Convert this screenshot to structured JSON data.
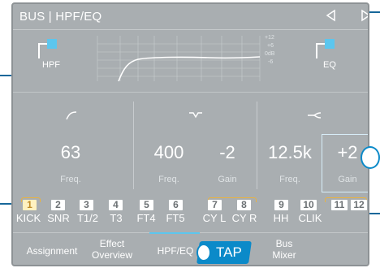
{
  "titlebar": {
    "title": "BUS | HPF/EQ",
    "prev_icon": "triangle-left-icon",
    "next_icon": "triangle-right-icon"
  },
  "graph": {
    "hpf_label": "HPF",
    "eq_label": "EQ",
    "db_labels": [
      "+12",
      "+6",
      "0dB",
      "-6"
    ]
  },
  "params": [
    {
      "band": "hpf",
      "icon": "highpass-icon",
      "value": "63",
      "label": "Freq."
    },
    {
      "band": "mid",
      "icon": "peak-icon",
      "value": "400",
      "label": "Freq."
    },
    {
      "band": "mid",
      "icon": "peak-icon",
      "value": "-2",
      "label": "Gain"
    },
    {
      "band": "high",
      "icon": "shelf-icon",
      "value": "12.5k",
      "label": "Freq."
    },
    {
      "band": "high",
      "icon": "shelf-icon",
      "value": "+2",
      "label": "Gain"
    }
  ],
  "channels": [
    {
      "num": "1",
      "name": "KICK",
      "selected": true
    },
    {
      "num": "2",
      "name": "SNR"
    },
    {
      "num": "3",
      "name": "T1/2"
    },
    {
      "num": "4",
      "name": "T3"
    },
    {
      "num": "5",
      "name": "FT4"
    },
    {
      "num": "6",
      "name": "FT5"
    },
    {
      "num": "7",
      "name": "CY L"
    },
    {
      "num": "8",
      "name": "CY R"
    },
    {
      "num": "9",
      "name": "HH"
    },
    {
      "num": "10",
      "name": "CLIK"
    },
    {
      "num": "11",
      "name": ""
    },
    {
      "num": "12",
      "name": ""
    }
  ],
  "tabs": [
    {
      "label": "Assignment"
    },
    {
      "label": "Effect",
      "label2": "Overview"
    },
    {
      "label": "HPF/EQ",
      "active": true
    },
    {
      "label": "Bus",
      "label2": "Mixer"
    }
  ],
  "overlay": {
    "tap_label": "TAP"
  },
  "colors": {
    "panel": "#a9aeb1",
    "accent": "#5cc6ee",
    "callout": "#0b8ac9",
    "pair_bracket": "#e8b342"
  }
}
